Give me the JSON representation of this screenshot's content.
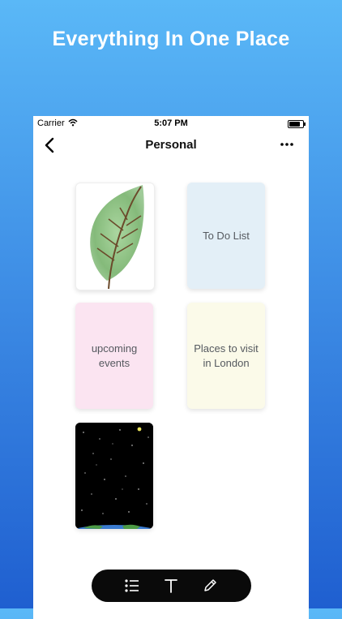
{
  "headline": "Everything In One Place",
  "status_bar": {
    "carrier": "Carrier",
    "time": "5:07 PM"
  },
  "nav": {
    "title": "Personal",
    "back_icon": "chevron-left-icon",
    "more_icon": "ellipsis-icon"
  },
  "notes": [
    {
      "type": "drawing",
      "subject": "leaf"
    },
    {
      "type": "text",
      "label": "To Do List",
      "color": "#e3eff7"
    },
    {
      "type": "text",
      "label": "upcoming events",
      "color": "#fbe4f1"
    },
    {
      "type": "text",
      "label": "Places to visit in London",
      "color": "#fbfae9"
    },
    {
      "type": "drawing",
      "subject": "starry-sky"
    }
  ],
  "toolbar": {
    "icons": [
      "checklist-icon",
      "text-icon",
      "pen-icon"
    ]
  },
  "colors": {
    "background_top": "#5ab8f7",
    "background_bottom": "#1f5fd0",
    "toolbar": "#0a0a0a"
  }
}
